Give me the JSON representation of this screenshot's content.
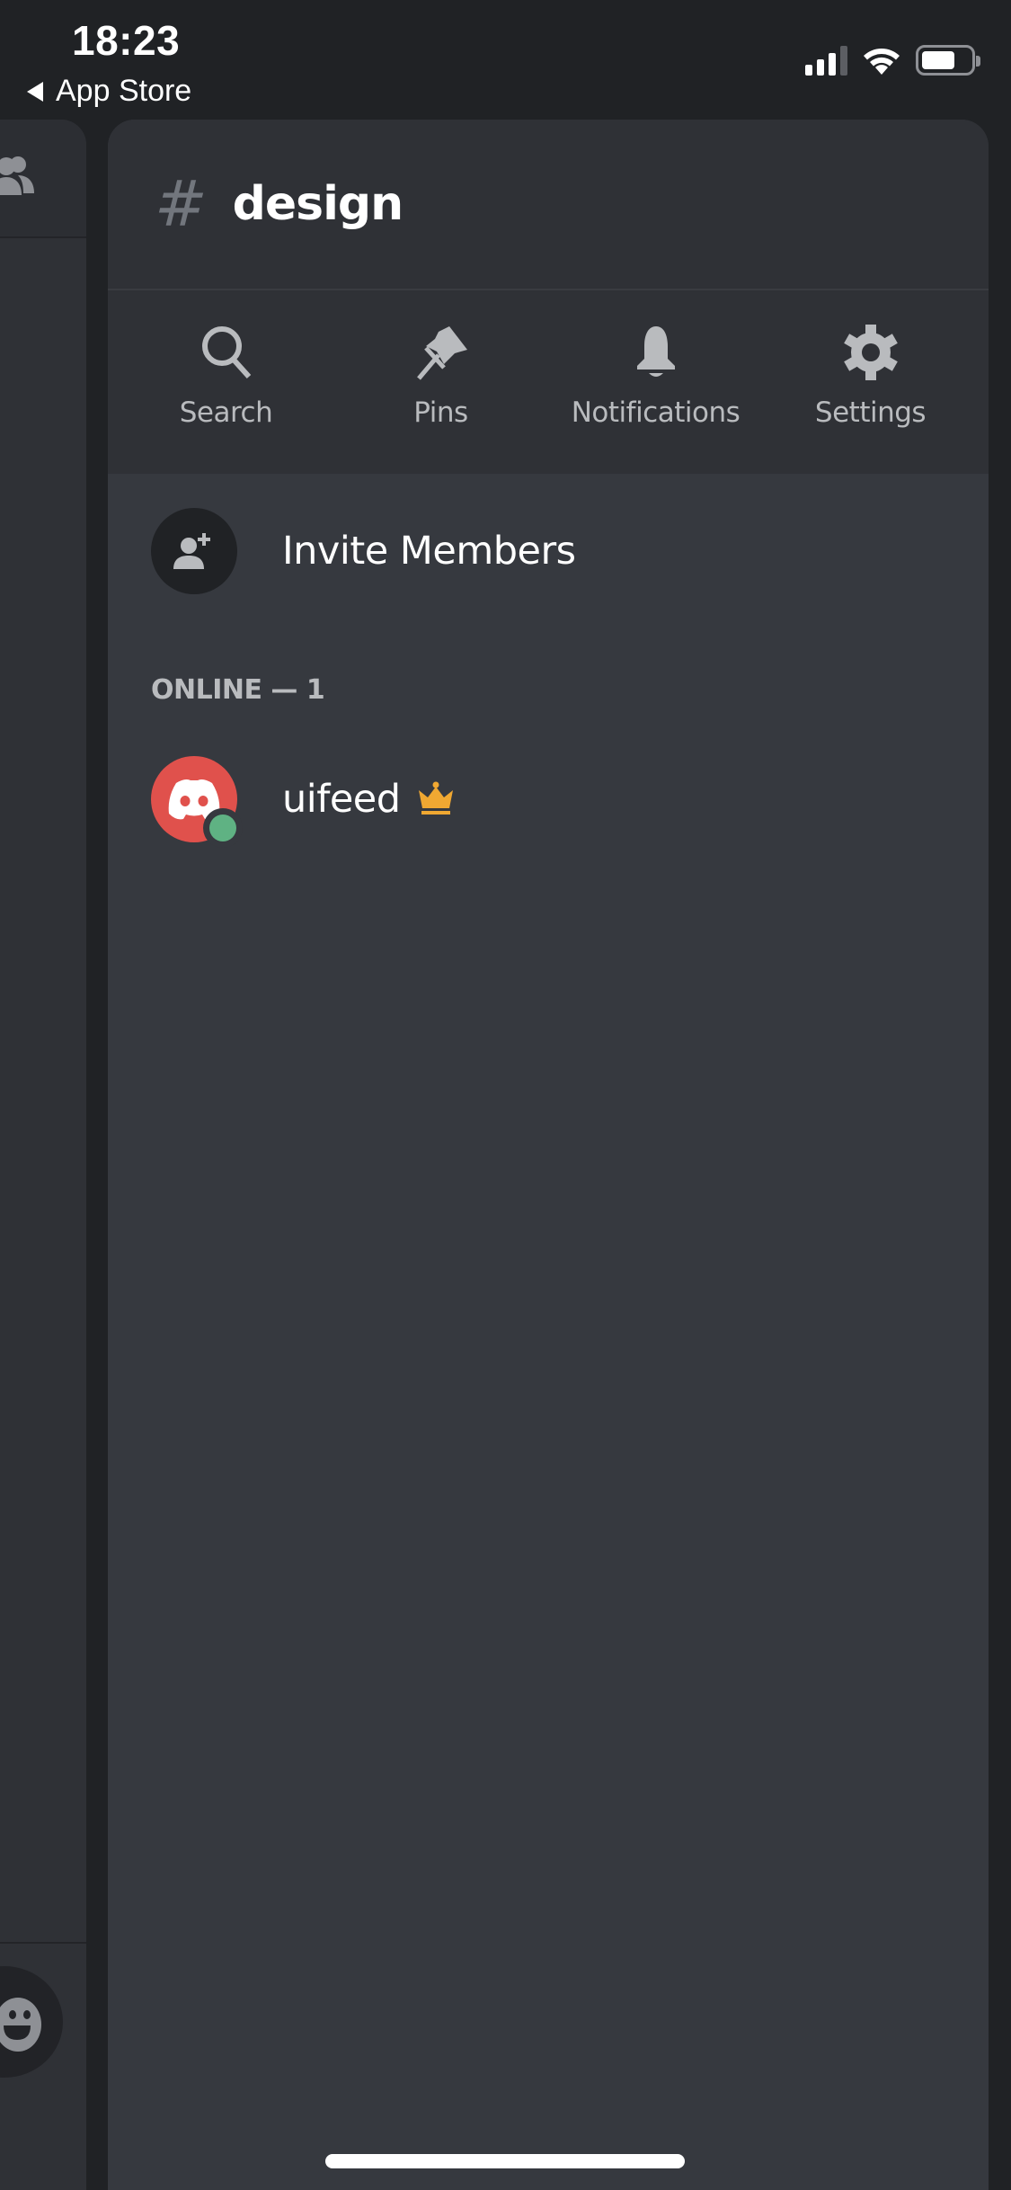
{
  "status_bar": {
    "time": "18:23",
    "back_label": "App Store",
    "icons": [
      "cellular-signal-icon",
      "wifi-icon",
      "battery-icon"
    ]
  },
  "left_panel": {
    "icons": [
      "friends-icon",
      "emoji-icon"
    ]
  },
  "channel": {
    "hash_symbol": "#",
    "name": "design"
  },
  "actions": [
    {
      "label": "Search",
      "icon": "search-icon"
    },
    {
      "label": "Pins",
      "icon": "pin-icon"
    },
    {
      "label": "Notifications",
      "icon": "bell-icon"
    },
    {
      "label": "Settings",
      "icon": "gear-icon"
    }
  ],
  "invite": {
    "label": "Invite Members",
    "icon": "add-user-icon"
  },
  "members": {
    "section_header": "ONLINE — 1",
    "items": [
      {
        "name": "uifeed",
        "status": "online",
        "badge": "crown-icon",
        "avatar_color": "#e0514c",
        "status_color": "#5fb283",
        "badge_color": "#f0a832"
      }
    ]
  },
  "colors": {
    "background": "#202225",
    "panel_header": "#2f3136",
    "panel_body": "#36393f",
    "muted_text": "#b9bbbe",
    "online": "#5fb283",
    "owner_crown": "#f0a832"
  }
}
